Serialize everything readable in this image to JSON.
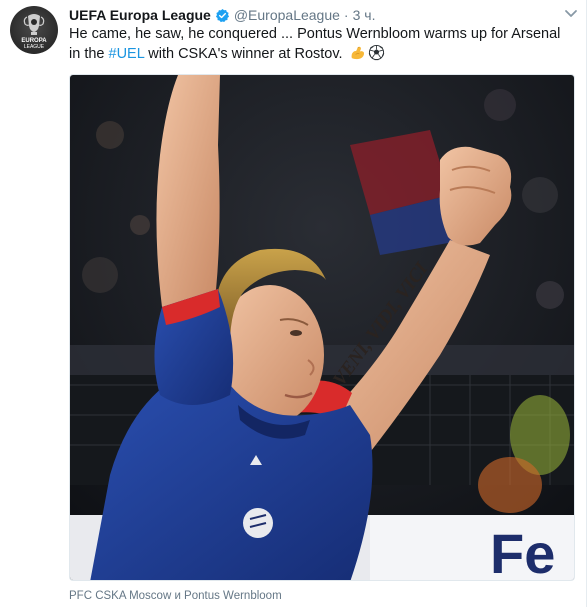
{
  "tweet": {
    "author_name": "UEFA Europa League",
    "handle": "@EuropaLeague",
    "separator": "·",
    "time": "3 ч.",
    "text_part1": "He came, he saw, he conquered ... Pontus Wernbloom warms up for Arsenal in the ",
    "hashtag": "#UEL",
    "text_part2": " with CSKA's winner at Rostov. ",
    "emojis": [
      "flexed-biceps",
      "soccer-ball"
    ],
    "verified": true
  },
  "avatar": {
    "logo_line1": "EUROPA",
    "logo_line2": "LEAGUE"
  },
  "media": {
    "tattoo_text": "VENI, VIDI, VICI",
    "banner_text": "Fe"
  },
  "caption": {
    "text": "PFC CSKA Moscow и Pontus Wernbloom"
  },
  "colors": {
    "link": "#1b95e0",
    "secondary_text": "#657786",
    "verified": "#1da1f2",
    "jersey": "#1f3a93",
    "jersey_red": "#d92b2b"
  }
}
